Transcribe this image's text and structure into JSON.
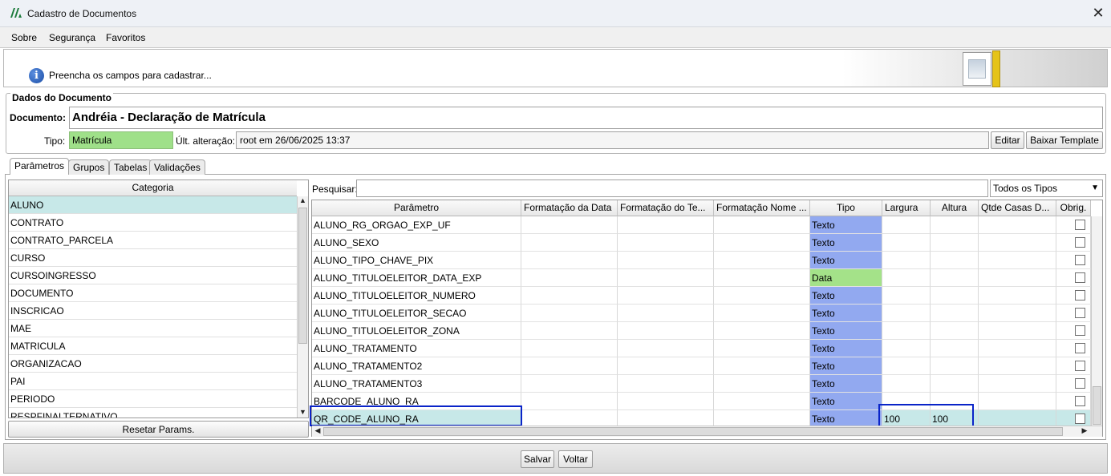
{
  "window": {
    "title": "Cadastro de Documentos",
    "close": "✕"
  },
  "menu": {
    "sobre": "Sobre",
    "seguranca": "Segurança",
    "favoritos": "Favoritos"
  },
  "info": {
    "text": "Preencha os campos para cadastrar...",
    "icon_glyph": "i"
  },
  "dados": {
    "legend": "Dados do Documento",
    "documento_label": "Documento:",
    "documento_value": "Andréia - Declaração de Matrícula",
    "tipo_label": "Tipo:",
    "tipo_value": "Matrícula",
    "alteracao_label": "Últ. alteração:",
    "alteracao_value": "root em 26/06/2025 13:37",
    "editar": "Editar",
    "baixar": "Baixar Template"
  },
  "tabs": {
    "parametros": "Parâmetros",
    "grupos": "Grupos",
    "tabelas": "Tabelas",
    "validacoes": "Validações"
  },
  "categoria": {
    "header": "Categoria",
    "items": [
      "ALUNO",
      "CONTRATO",
      "CONTRATO_PARCELA",
      "CURSO",
      "CURSOINGRESSO",
      "DOCUMENTO",
      "INSCRICAO",
      "MAE",
      "MATRICULA",
      "ORGANIZACAO",
      "PAI",
      "PERIODO",
      "RESPFINALTERNATIVO"
    ],
    "reset": "Resetar Params."
  },
  "search": {
    "label": "Pesquisar:",
    "value": "",
    "filter": "Todos os Tipos"
  },
  "params": {
    "headers": [
      "Parâmetro",
      "Formatação da Data",
      "Formatação do Te...",
      "Formatação Nome ...",
      "Tipo",
      "Largura",
      "Altura",
      "Qtde Casas D...",
      "Obrig."
    ],
    "rows": [
      {
        "nome": "ALUNO_RG_ORGAO_EXP_UF",
        "tipo": "Texto",
        "largura": "",
        "altura": ""
      },
      {
        "nome": "ALUNO_SEXO",
        "tipo": "Texto",
        "largura": "",
        "altura": ""
      },
      {
        "nome": "ALUNO_TIPO_CHAVE_PIX",
        "tipo": "Texto",
        "largura": "",
        "altura": ""
      },
      {
        "nome": "ALUNO_TITULOELEITOR_DATA_EXP",
        "tipo": "Data",
        "largura": "",
        "altura": ""
      },
      {
        "nome": "ALUNO_TITULOELEITOR_NUMERO",
        "tipo": "Texto",
        "largura": "",
        "altura": ""
      },
      {
        "nome": "ALUNO_TITULOELEITOR_SECAO",
        "tipo": "Texto",
        "largura": "",
        "altura": ""
      },
      {
        "nome": "ALUNO_TITULOELEITOR_ZONA",
        "tipo": "Texto",
        "largura": "",
        "altura": ""
      },
      {
        "nome": "ALUNO_TRATAMENTO",
        "tipo": "Texto",
        "largura": "",
        "altura": ""
      },
      {
        "nome": "ALUNO_TRATAMENTO2",
        "tipo": "Texto",
        "largura": "",
        "altura": ""
      },
      {
        "nome": "ALUNO_TRATAMENTO3",
        "tipo": "Texto",
        "largura": "",
        "altura": ""
      },
      {
        "nome": "BARCODE_ALUNO_RA",
        "tipo": "Texto",
        "largura": "",
        "altura": ""
      },
      {
        "nome": "QR_CODE_ALUNO_RA",
        "tipo": "Texto",
        "largura": "100",
        "altura": "100"
      }
    ]
  },
  "footer": {
    "salvar": "Salvar",
    "voltar": "Voltar"
  },
  "colors": {
    "texto": "#92a9f0",
    "data": "#a4e289",
    "selected": "#c7e8e8",
    "highlight": "#0a24c8"
  }
}
